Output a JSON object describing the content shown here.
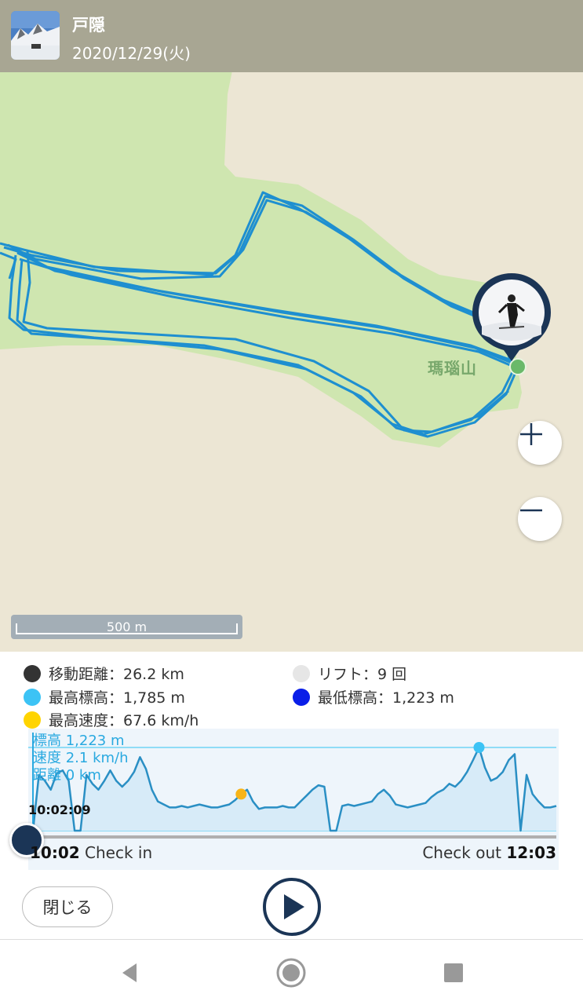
{
  "header": {
    "title": "戸隠",
    "date": "2020/12/29(火)"
  },
  "map": {
    "peak_label": "瑪瑙山",
    "scale_label": "500 m",
    "zoom_in": "+",
    "zoom_out": "−",
    "track_color": "#1e8fd0"
  },
  "stats": {
    "distance": "移動距離：26.2 km",
    "lifts": "リフト：9 回",
    "max_altitude": "最高標高：1,785 m",
    "min_altitude": "最低標高：1,223 m",
    "max_speed": "最高速度：67.6 km/h"
  },
  "chart": {
    "altitude": "標高 1,223 m",
    "speed": "速度 2.1 km/h",
    "distance": "距離 0 km",
    "time": "10:02:09",
    "checkin_time": "10:02",
    "checkin_label": " Check in",
    "checkout_label": "Check out ",
    "checkout_time": "12:03"
  },
  "chart_data": {
    "type": "line",
    "series": [
      {
        "values": [
          1223,
          1600,
          1560,
          1500,
          1610,
          1630,
          1560,
          1223,
          1223,
          1600,
          1540,
          1500,
          1560,
          1630,
          1560,
          1520,
          1560,
          1620,
          1720,
          1640,
          1500,
          1420,
          1400,
          1380,
          1380,
          1390,
          1380,
          1390,
          1400,
          1390,
          1380,
          1380,
          1390,
          1400,
          1430,
          1470,
          1500,
          1420,
          1370,
          1380,
          1380,
          1380,
          1390,
          1380,
          1380,
          1420,
          1460,
          1500,
          1530,
          1520,
          1223,
          1223,
          1390,
          1400,
          1390,
          1400,
          1410,
          1420,
          1470,
          1500,
          1460,
          1400,
          1390,
          1380,
          1390,
          1400,
          1410,
          1450,
          1480,
          1500,
          1540,
          1520,
          1560,
          1620,
          1700,
          1785,
          1650,
          1560,
          1580,
          1620,
          1700,
          1740,
          1223,
          1600,
          1470,
          1420,
          1380,
          1380,
          1390
        ]
      }
    ],
    "markers": {
      "max_altitude": 1785,
      "max_speed_altitude": 1470
    },
    "ylim": [
      1223,
      1785
    ]
  },
  "buttons": {
    "close": "閉じる"
  },
  "colors": {
    "navy": "#1b3556",
    "accent": "#29a9e0",
    "stat_distance": "#333333",
    "stat_lift": "#e6e6e6",
    "stat_max": "#3cc3f5",
    "stat_min": "#0a1ee8",
    "stat_speed": "#ffd400"
  },
  "icons": {
    "zoom_in": "plus-icon",
    "zoom_out": "minus-icon",
    "play": "play-icon",
    "nav_back": "back-triangle-icon",
    "nav_home": "home-circle-icon",
    "nav_recent": "recent-square-icon"
  }
}
